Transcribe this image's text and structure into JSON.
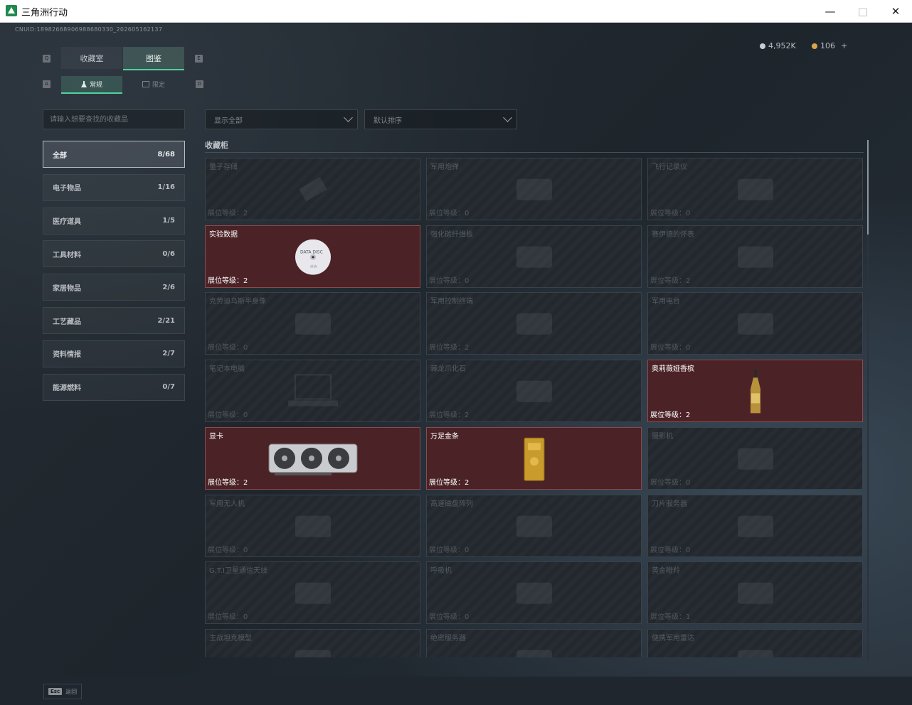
{
  "window": {
    "title": "三角洲行动"
  },
  "cnuid": "CNUID:18982668906988680330_202605162137",
  "tabs": {
    "key_left": "Q",
    "key_right": "E",
    "items": [
      {
        "label": "收藏室"
      },
      {
        "label": "图鉴"
      }
    ]
  },
  "subtabs": {
    "key_left": "A",
    "key_right": "D",
    "items": [
      {
        "label": "常规"
      },
      {
        "label": "限定"
      }
    ]
  },
  "currency": {
    "silver": "4,952K",
    "gold": "106",
    "add": "+"
  },
  "search": {
    "placeholder": "请输入想要查找的收藏品"
  },
  "filters": {
    "display": "显示全部",
    "sort": "默认排序"
  },
  "categories": [
    {
      "label": "全部",
      "count": "8/68"
    },
    {
      "label": "电子物品",
      "count": "1/16"
    },
    {
      "label": "医疗道具",
      "count": "1/5"
    },
    {
      "label": "工具材料",
      "count": "0/6"
    },
    {
      "label": "家居物品",
      "count": "2/6"
    },
    {
      "label": "工艺藏品",
      "count": "2/21"
    },
    {
      "label": "资料情报",
      "count": "2/7"
    },
    {
      "label": "能源燃料",
      "count": "0/7"
    }
  ],
  "section": {
    "title": "收藏柜"
  },
  "items": [
    {
      "name": "量子存储",
      "level": "展位等级：2",
      "owned": false,
      "icon": "usb-drive-icon"
    },
    {
      "name": "军用炮弹",
      "level": "展位等级：0",
      "owned": false,
      "icon": "shell-icon"
    },
    {
      "name": "飞行记录仪",
      "level": "展位等级：0",
      "owned": false,
      "icon": "black-box-icon"
    },
    {
      "name": "实验数据",
      "level": "展位等级：2",
      "owned": true,
      "icon": "cd-disc-icon"
    },
    {
      "name": "强化碳纤维板",
      "level": "展位等级：0",
      "owned": false,
      "icon": "carbon-plate-icon"
    },
    {
      "name": "赛伊德的怀表",
      "level": "展位等级：2",
      "owned": false,
      "icon": "pocket-watch-icon"
    },
    {
      "name": "克劳迪乌斯半身像",
      "level": "展位等级：0",
      "owned": false,
      "icon": "bust-icon"
    },
    {
      "name": "军用控制终端",
      "level": "展位等级：2",
      "owned": false,
      "icon": "terminal-icon"
    },
    {
      "name": "军用电台",
      "level": "展位等级：0",
      "owned": false,
      "icon": "radio-icon"
    },
    {
      "name": "笔记本电脑",
      "level": "展位等级：0",
      "owned": false,
      "icon": "laptop-icon"
    },
    {
      "name": "棘龙爪化石",
      "level": "展位等级：2",
      "owned": false,
      "icon": "fossil-claw-icon"
    },
    {
      "name": "奥莉薇娅香槟",
      "level": "展位等级：2",
      "owned": true,
      "icon": "champagne-bottle-icon"
    },
    {
      "name": "显卡",
      "level": "展位等级：2",
      "owned": true,
      "icon": "graphics-card-icon"
    },
    {
      "name": "万足金条",
      "level": "展位等级：2",
      "owned": true,
      "icon": "gold-bar-icon"
    },
    {
      "name": "摄影机",
      "level": "展位等级：0",
      "owned": false,
      "icon": "camera-icon"
    },
    {
      "name": "军用无人机",
      "level": "展位等级：0",
      "owned": false,
      "icon": "drone-icon"
    },
    {
      "name": "高速磁盘阵列",
      "level": "展位等级：0",
      "owned": false,
      "icon": "disk-array-icon"
    },
    {
      "name": "刀片服务器",
      "level": "展位等级：0",
      "owned": false,
      "icon": "blade-server-icon"
    },
    {
      "name": "G.T.I卫星通信天线",
      "level": "展位等级：0",
      "owned": false,
      "icon": "satellite-dish-icon"
    },
    {
      "name": "呼吸机",
      "level": "展位等级：0",
      "owned": false,
      "icon": "ventilator-icon"
    },
    {
      "name": "黄金瞪羚",
      "level": "展位等级：1",
      "owned": false,
      "icon": "gazelle-statue-icon"
    },
    {
      "name": "主战坦克模型",
      "level": "",
      "owned": false,
      "icon": "tank-model-icon"
    },
    {
      "name": "绝密服务器",
      "level": "",
      "owned": false,
      "icon": "server-icon"
    },
    {
      "name": "便携军用雷达",
      "level": "",
      "owned": false,
      "icon": "radar-icon"
    }
  ],
  "footer": {
    "esc_key": "Esc",
    "esc_label": "返回"
  }
}
